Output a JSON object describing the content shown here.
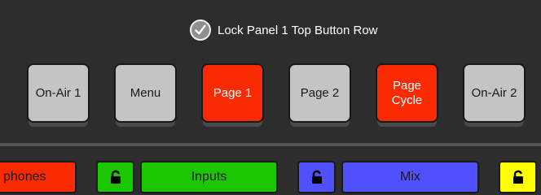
{
  "lock_option": {
    "label": "Lock Panel 1 Top Button Row",
    "checked": true
  },
  "top_buttons": [
    {
      "label": "On-Air 1",
      "color": "#c4c4c4"
    },
    {
      "label": "Menu",
      "color": "#c4c4c4"
    },
    {
      "label": "Page 1",
      "color": "#fa2a02"
    },
    {
      "label": "Page 2",
      "color": "#c4c4c4"
    },
    {
      "label": "Page\nCycle",
      "color": "#fa2a02"
    },
    {
      "label": "On-Air 2",
      "color": "#c4c4c4"
    }
  ],
  "bottom_row": {
    "phones_label": "phones",
    "inputs_label": "Inputs",
    "mix_label": "Mix",
    "colors": {
      "phones": "#fa2a02",
      "inputs": "#1cc600",
      "mix": "#5050ff",
      "yellow": "#ffff00"
    }
  }
}
